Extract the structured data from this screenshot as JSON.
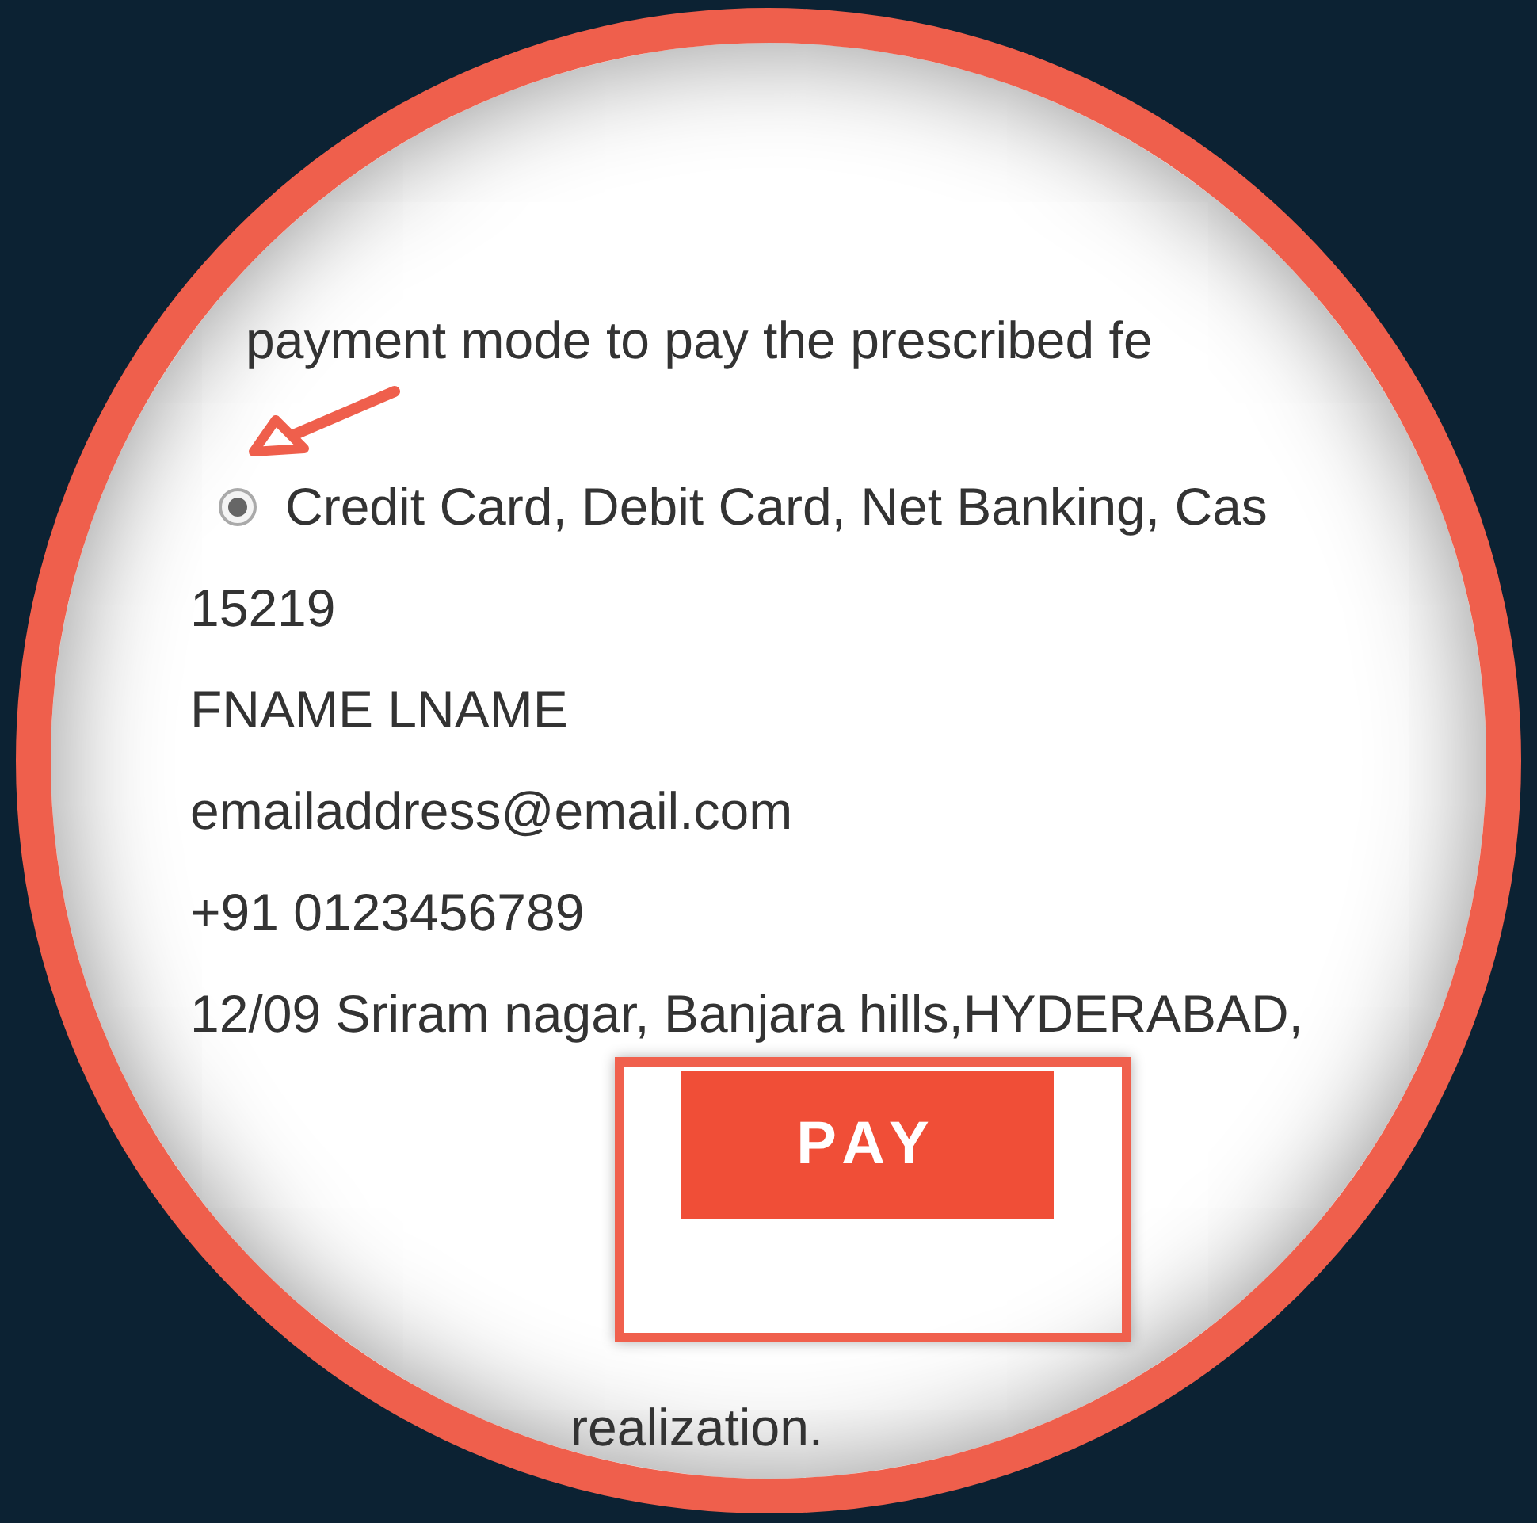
{
  "instruction": "payment mode to pay the prescribed fe",
  "payment_options": [
    {
      "label": "Credit Card, Debit Card, Net Banking, Cas",
      "selected": true
    }
  ],
  "details": [
    "15219",
    "FNAME LNAME",
    "emailaddress@email.com",
    "+91 0123456789",
    "12/09 Sriram nagar, Banjara hills,HYDERABAD,"
  ],
  "pay_button": "PAY",
  "footer_text": "realization."
}
